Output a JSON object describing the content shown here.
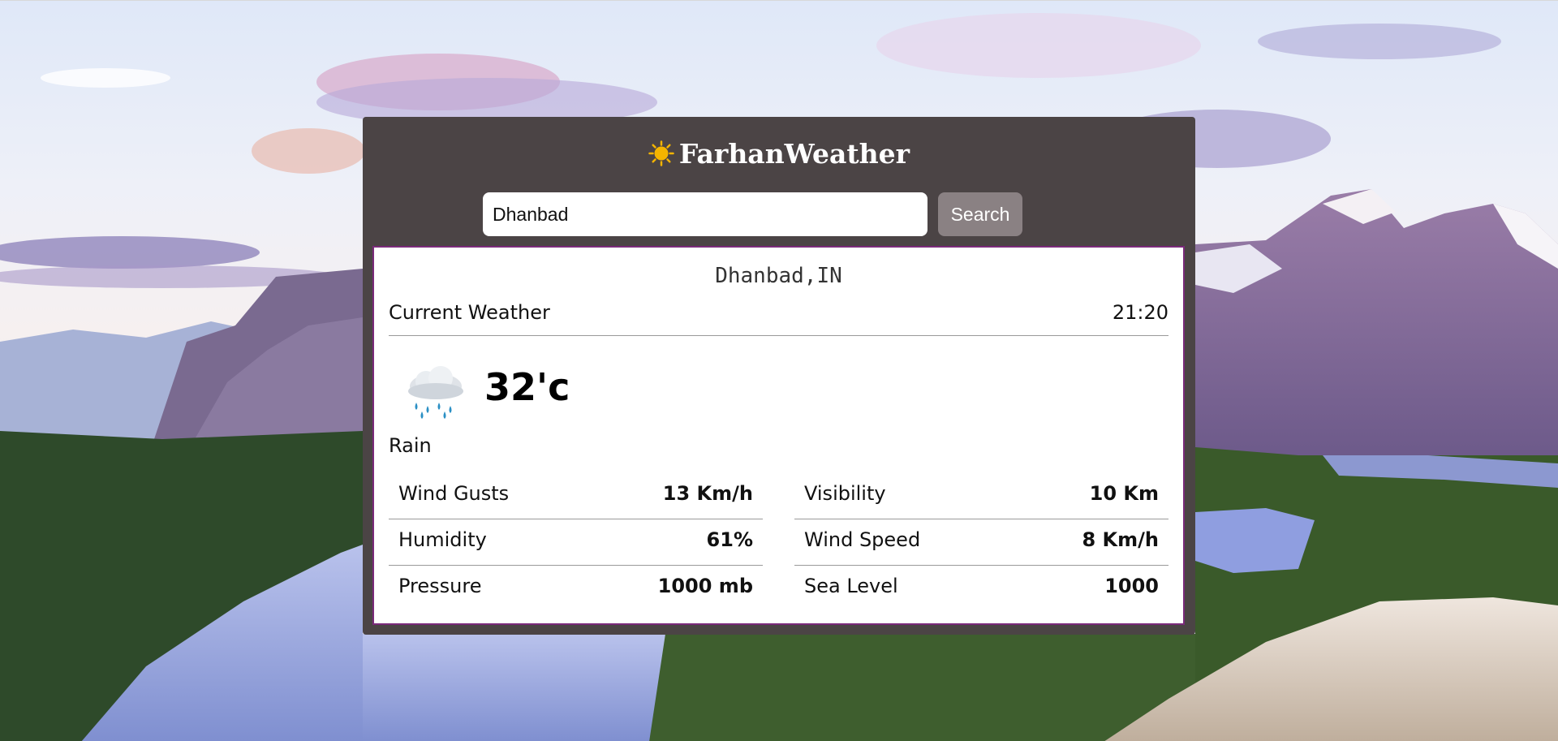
{
  "app": {
    "brand_title": "FarhanWeather",
    "brand_icon": "sun-icon"
  },
  "search": {
    "value": "Dhanbad",
    "placeholder": "",
    "button_label": "Search"
  },
  "weather": {
    "location": "Dhanbad,IN",
    "section_label": "Current Weather",
    "time": "21:20",
    "icon": "rain-cloud-icon",
    "temperature": "32'c",
    "condition": "Rain",
    "stats_left": [
      {
        "label": "Wind Gusts",
        "value": "13 Km/h"
      },
      {
        "label": "Humidity",
        "value": "61%"
      },
      {
        "label": "Pressure",
        "value": "1000 mb"
      }
    ],
    "stats_right": [
      {
        "label": "Visibility",
        "value": "10 Km"
      },
      {
        "label": "Wind Speed",
        "value": "8 Km/h"
      },
      {
        "label": "Sea Level",
        "value": "1000"
      }
    ]
  },
  "colors": {
    "card_background": "#4b4445",
    "button_background": "#8a8183",
    "panel_border": "#7a2a7a",
    "sun": "#f4b400",
    "rain_drop": "#2a8fc4"
  }
}
